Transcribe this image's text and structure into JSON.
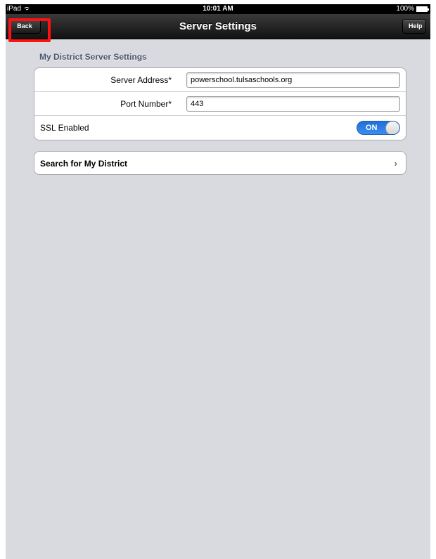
{
  "status_bar": {
    "carrier": "iPad",
    "time": "10:01 AM",
    "battery": "100%"
  },
  "nav_bar": {
    "title": "Server Settings",
    "back_label": "Back",
    "help_label": "Help"
  },
  "settings": {
    "section_title": "My District Server Settings",
    "server_address_label": "Server Address*",
    "server_address_value": "powerschool.tulsaschools.org",
    "port_label": "Port Number*",
    "port_value": "443",
    "ssl_label": "SSL Enabled",
    "ssl_toggle": "ON"
  },
  "search": {
    "label": "Search for My District",
    "chevron": "›"
  },
  "colors": {
    "highlight": "#ff1111",
    "toggle_on": "#1e6fd8",
    "section_header": "#4c566c"
  },
  "icons": {
    "wifi": "wifi-icon",
    "battery": "battery-icon",
    "chevron": "chevron-right-icon"
  }
}
